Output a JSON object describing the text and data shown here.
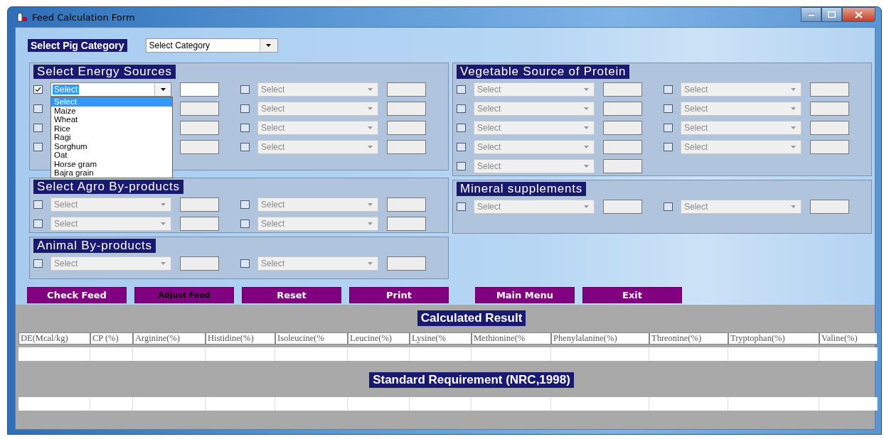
{
  "window": {
    "title": "Feed Calculation Form"
  },
  "category": {
    "label": "Select Pig Category",
    "value": "Select Category"
  },
  "left_sections": [
    {
      "title": "Select Energy Sources",
      "columns": [
        [
          {
            "checked": true,
            "disabled": false,
            "value": "Select"
          },
          {
            "checked": false,
            "disabled": true
          },
          {
            "checked": false,
            "disabled": true
          },
          {
            "checked": false,
            "disabled": true
          }
        ],
        [
          {
            "checked": false,
            "disabled": true,
            "value": "Select"
          },
          {
            "checked": false,
            "disabled": true,
            "value": "Select"
          },
          {
            "checked": false,
            "disabled": true,
            "value": "Select"
          },
          {
            "checked": false,
            "disabled": true,
            "value": "Select"
          }
        ]
      ]
    },
    {
      "title": "Select Agro By-products",
      "columns": [
        [
          {
            "checked": false,
            "disabled": true,
            "value": "Select"
          },
          {
            "checked": false,
            "disabled": true,
            "value": "Select"
          }
        ],
        [
          {
            "checked": false,
            "disabled": true,
            "value": "Select"
          },
          {
            "checked": false,
            "disabled": true,
            "value": "Select"
          }
        ]
      ]
    },
    {
      "title": "Animal By-products",
      "columns": [
        [
          {
            "checked": false,
            "disabled": true,
            "value": "Select"
          }
        ],
        [
          {
            "checked": false,
            "disabled": true,
            "value": "Select"
          }
        ]
      ]
    }
  ],
  "right_sections": [
    {
      "title": "Vegetable Source of Protein",
      "columns": [
        [
          {
            "checked": false,
            "disabled": true,
            "value": "Select"
          },
          {
            "checked": false,
            "disabled": true,
            "value": "Select"
          },
          {
            "checked": false,
            "disabled": true,
            "value": "Select"
          },
          {
            "checked": false,
            "disabled": true,
            "value": "Select"
          },
          {
            "checked": false,
            "disabled": true,
            "value": "Select"
          }
        ],
        [
          {
            "checked": false,
            "disabled": true,
            "value": "Select"
          },
          {
            "checked": false,
            "disabled": true,
            "value": "Select"
          },
          {
            "checked": false,
            "disabled": true,
            "value": "Select"
          },
          {
            "checked": false,
            "disabled": true,
            "value": "Select"
          }
        ]
      ]
    },
    {
      "title": "Mineral supplements",
      "columns": [
        [
          {
            "checked": false,
            "disabled": true,
            "value": "Select"
          }
        ],
        [
          {
            "checked": false,
            "disabled": true,
            "value": "Select"
          }
        ]
      ]
    }
  ],
  "open_list": {
    "options": [
      {
        "label": "Select",
        "selected": true
      },
      {
        "label": "Maize",
        "selected": false
      },
      {
        "label": "Wheat",
        "selected": false
      },
      {
        "label": "Rice",
        "selected": false
      },
      {
        "label": "Ragi",
        "selected": false
      },
      {
        "label": "Sorghum",
        "selected": false
      },
      {
        "label": "Oat",
        "selected": false
      },
      {
        "label": "Horse gram",
        "selected": false
      },
      {
        "label": "Bajra grain",
        "selected": false
      }
    ]
  },
  "buttons": [
    {
      "label": "Check Feed",
      "disabled": false
    },
    {
      "label": "Adjust Feed",
      "disabled": true
    },
    {
      "label": "Reset",
      "disabled": false
    },
    {
      "label": "Print",
      "disabled": false
    },
    {
      "label": "Main Menu",
      "disabled": false
    },
    {
      "label": "Exit",
      "disabled": false
    }
  ],
  "results": {
    "title": "Calculated Result",
    "columns": [
      "DE(Mcal/kg)",
      "CP (%)",
      "Arginine(%)",
      "Histidine(%)",
      "Isoleucine(%",
      "Leucine(%)",
      "Lysine(%",
      "Methionine(%",
      "Phenylalanine(%)",
      "Threonine(%)",
      "Tryptophan(%)",
      "Valine(%)"
    ]
  },
  "standard": {
    "title": "Standard Requirement (NRC,1998)"
  }
}
